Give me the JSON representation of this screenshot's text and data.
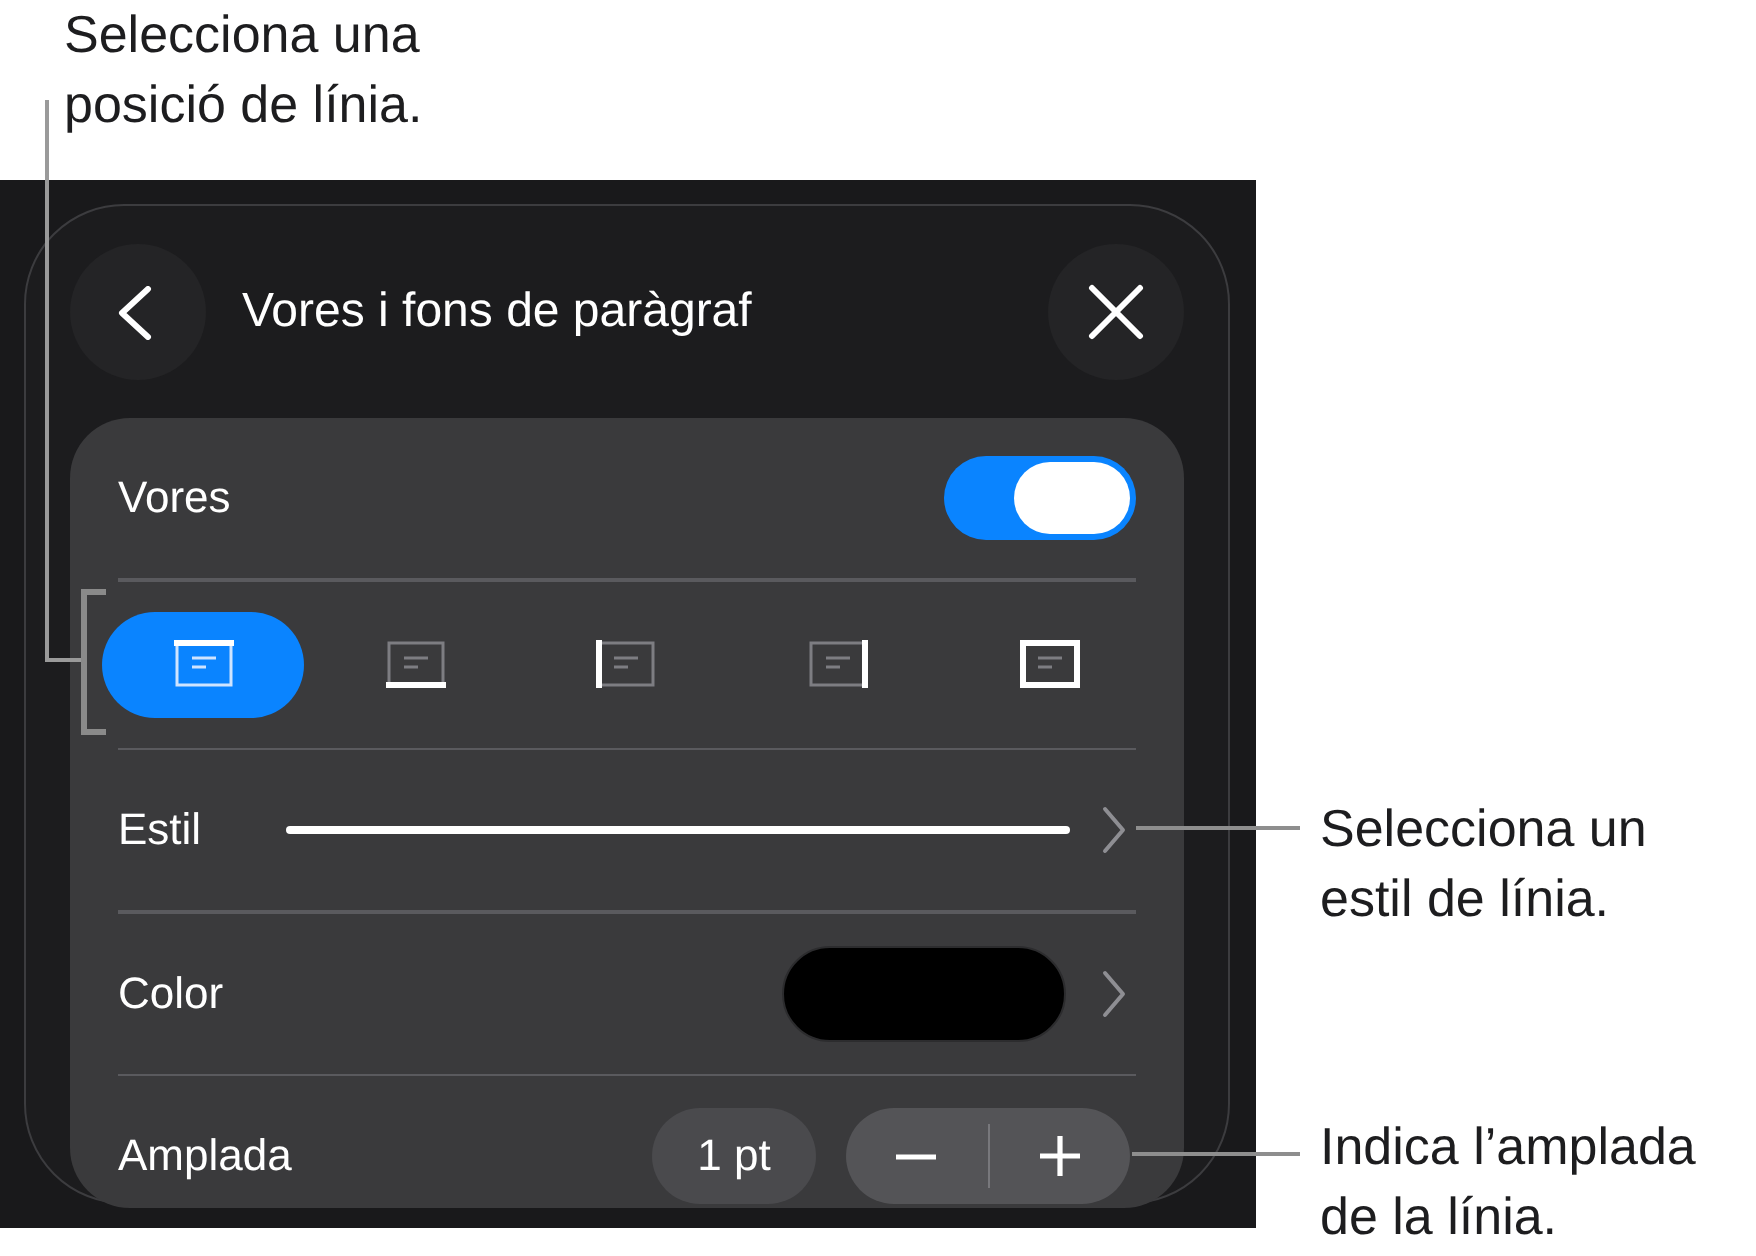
{
  "callouts": [
    {
      "text": "Selecciona una posició de línia."
    },
    {
      "text": "Selecciona un estil de línia."
    },
    {
      "text": "Indica l’amplada de la línia."
    }
  ],
  "panel": {
    "title": "Vores i fons de paràgraf",
    "rows": [
      {
        "kind": "toggle",
        "label": "Vores",
        "on": true
      },
      {
        "kind": "positions",
        "options": [
          {
            "kind": "top",
            "selected": true
          },
          {
            "kind": "bottom",
            "selected": false
          },
          {
            "kind": "left",
            "selected": false
          },
          {
            "kind": "right",
            "selected": false
          },
          {
            "kind": "all",
            "selected": false
          }
        ]
      },
      {
        "kind": "style",
        "label": "Estil"
      },
      {
        "kind": "color",
        "label": "Color",
        "color": "#000000"
      },
      {
        "kind": "stepper",
        "label": "Amplada",
        "value": "1 pt"
      }
    ]
  }
}
